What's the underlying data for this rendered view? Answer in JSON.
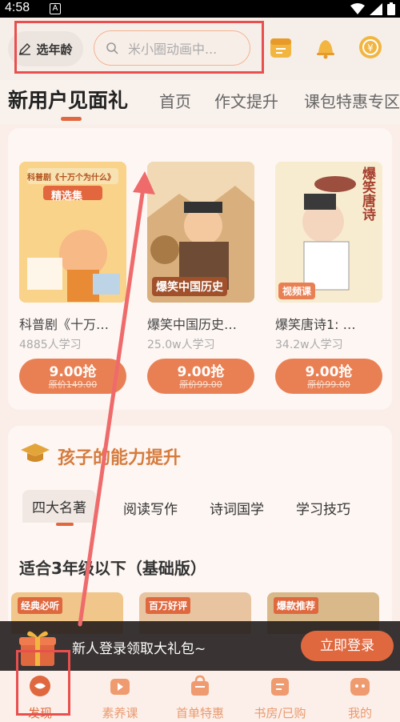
{
  "status_bar": {
    "time": "4:58",
    "notif": "A"
  },
  "header": {
    "age_selector": "选年龄",
    "search_placeholder": "米小圈动画中..."
  },
  "tabs": [
    {
      "label": "新用户见面礼",
      "active": true
    },
    {
      "label": "首页"
    },
    {
      "label": "作文提升"
    },
    {
      "label": "课包特惠专区"
    }
  ],
  "products": [
    {
      "title": "科普剧《十万…",
      "learners": "4885人学习",
      "price": "9.00抢",
      "original": "原价149.00",
      "thumb_text": [
        "科普剧《十万个为什么》",
        "精选集"
      ]
    },
    {
      "title": "爆笑中国历史…",
      "learners": "25.0w人学习",
      "price": "9.00抢",
      "original": "原价99.00",
      "thumb_text": [
        "爆笑中国历史"
      ]
    },
    {
      "title": "爆笑唐诗1: …",
      "learners": "34.2w人学习",
      "price": "9.00抢",
      "original": "原价99.00",
      "thumb_text": [
        "爆笑唐诗"
      ],
      "badge": "视频课"
    }
  ],
  "ability": {
    "title": "孩子的能力提升",
    "subtabs": [
      "四大名著",
      "阅读写作",
      "诗词国学",
      "学习技巧"
    ],
    "level_title": "适合3年级以下（基础版）",
    "mini_thumbs": [
      {
        "text": "经典必听"
      },
      {
        "text": "百万好评"
      },
      {
        "text": "爆款推荐"
      }
    ]
  },
  "promo": {
    "text": "新人登录领取大礼包~",
    "button": "立即登录"
  },
  "bottom_nav": [
    {
      "label": "发现",
      "active": true
    },
    {
      "label": "素养课"
    },
    {
      "label": "首单特惠"
    },
    {
      "label": "书房/已购"
    },
    {
      "label": "我的"
    }
  ],
  "colors": {
    "accent": "#e0683f",
    "annotation": "#e94f4f"
  }
}
